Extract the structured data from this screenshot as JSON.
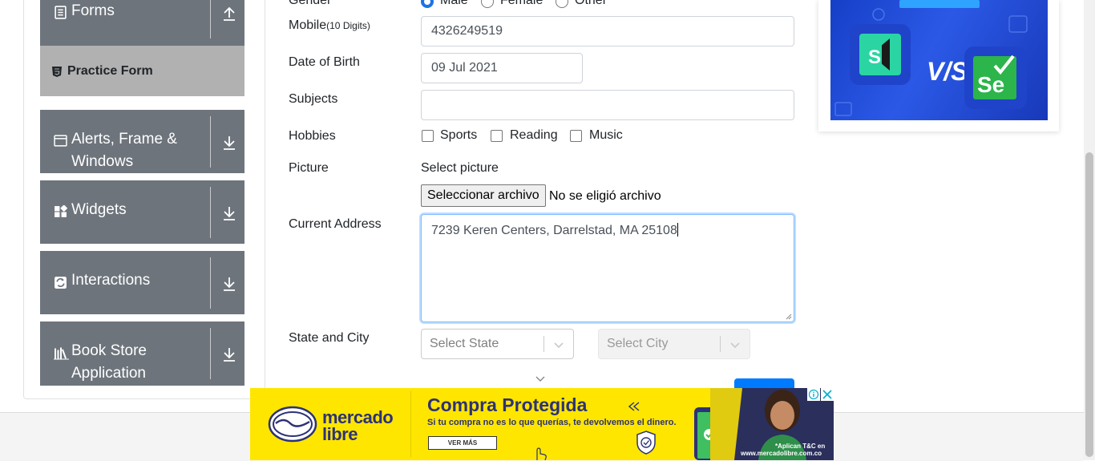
{
  "sidebar": {
    "groups": [
      {
        "label": "Forms",
        "icon": "form-icon"
      },
      {
        "label_line1": "Alerts, Frame &",
        "label_line2": "Windows",
        "icon": "window-icon"
      },
      {
        "label": "Widgets",
        "icon": "widgets-icon"
      },
      {
        "label": "Interactions",
        "icon": "interactions-icon"
      },
      {
        "label_line1": "Book Store",
        "label_line2": "Application",
        "icon": "bookstore-icon"
      }
    ],
    "active_item": {
      "label": "Practice Form",
      "icon": "html5-icon"
    }
  },
  "form": {
    "gender": {
      "label": "Gender",
      "options": [
        "Male",
        "Female",
        "Other"
      ],
      "selected": "Male"
    },
    "mobile": {
      "label": "Mobile",
      "hint": "(10 Digits)",
      "value": "4326249519"
    },
    "dob": {
      "label": "Date of Birth",
      "value": "09 Jul 2021"
    },
    "subjects": {
      "label": "Subjects",
      "value": ""
    },
    "hobbies": {
      "label": "Hobbies",
      "options": [
        "Sports",
        "Reading",
        "Music"
      ],
      "checked": []
    },
    "picture": {
      "label": "Picture",
      "prompt": "Select picture",
      "button": "Seleccionar archivo",
      "status": "No se eligió archivo"
    },
    "address": {
      "label": "Current Address",
      "value": "7239 Keren Centers, Darrelstad, MA 25108"
    },
    "state_city": {
      "label": "State and City",
      "state_placeholder": "Select State",
      "city_placeholder": "Select City"
    }
  },
  "ads": {
    "side": {
      "primary_color": "#1f4bd8"
    },
    "bottom": {
      "brand_line1": "mercado",
      "brand_line2": "libre",
      "headline": "Compra Protegida",
      "subtext": "Si tu compra no es lo que querías, te devolvemos el dinero.",
      "cta": "VER MÁS",
      "legal_line1": "*Aplican T&C en",
      "legal_line2": "www.mercadolibre.com.co",
      "bg_color": "#ffe600",
      "text_color": "#2d3277"
    }
  },
  "colors": {
    "sidebar_bg": "#6d747c",
    "active_bg": "#b1b1b1",
    "accent": "#007bff"
  }
}
